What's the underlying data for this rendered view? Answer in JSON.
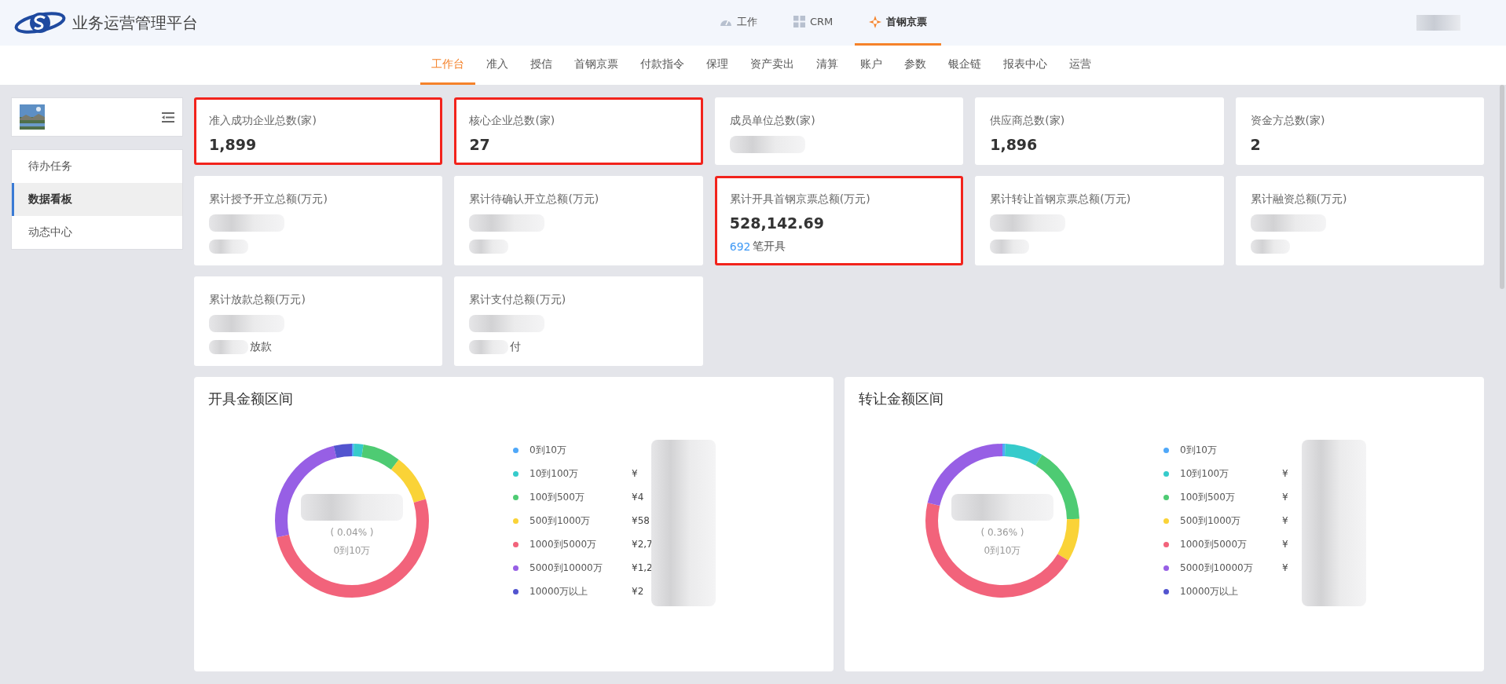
{
  "header": {
    "logo_text": "业务运营管理平台",
    "nav": [
      {
        "label": "工作",
        "selected": false
      },
      {
        "label": "CRM",
        "selected": false
      },
      {
        "label": "首钢京票",
        "selected": true
      }
    ]
  },
  "menu": [
    {
      "label": "工作台",
      "selected": true
    },
    {
      "label": "准入",
      "selected": false
    },
    {
      "label": "授信",
      "selected": false
    },
    {
      "label": "首钢京票",
      "selected": false
    },
    {
      "label": "付款指令",
      "selected": false
    },
    {
      "label": "保理",
      "selected": false
    },
    {
      "label": "资产卖出",
      "selected": false
    },
    {
      "label": "清算",
      "selected": false
    },
    {
      "label": "账户",
      "selected": false
    },
    {
      "label": "参数",
      "selected": false
    },
    {
      "label": "银企链",
      "selected": false
    },
    {
      "label": "报表中心",
      "selected": false
    },
    {
      "label": "运营",
      "selected": false
    }
  ],
  "sidebar": {
    "items": [
      {
        "label": "待办任务",
        "selected": false
      },
      {
        "label": "数据看板",
        "selected": true
      },
      {
        "label": "动态中心",
        "selected": false
      }
    ]
  },
  "cards": [
    {
      "title": "准入成功企业总数(家)",
      "value": "1,899",
      "highlighted": true
    },
    {
      "title": "核心企业总数(家)",
      "value": "27",
      "highlighted": true
    },
    {
      "title": "成员单位总数(家)",
      "redacted": true,
      "highlighted": false
    },
    {
      "title": "供应商总数(家)",
      "value": "1,896",
      "highlighted": false
    },
    {
      "title": "资金方总数(家)",
      "value": "2",
      "highlighted": false
    },
    {
      "title": "累计授予开立总额(万元)",
      "redacted": true,
      "highlighted": false,
      "footer": {
        "redacted": true
      }
    },
    {
      "title": "累计待确认开立总额(万元)",
      "redacted": true,
      "highlighted": false,
      "footer": {
        "redacted": true
      }
    },
    {
      "title": "累计开具首钢京票总额(万元)",
      "value": "528,142.69",
      "highlighted": true,
      "footer": {
        "count": "692",
        "text": "笔开具"
      }
    },
    {
      "title": "累计转让首钢京票总额(万元)",
      "redacted": true,
      "highlighted": false,
      "footer": {
        "redacted": true
      }
    },
    {
      "title": "累计融资总额(万元)",
      "redacted": true,
      "highlighted": false,
      "footer": {
        "redacted": true
      }
    },
    {
      "title": "累计放款总额(万元)",
      "redacted": true,
      "highlighted": false,
      "footer": {
        "redacted": true,
        "text": "放款"
      }
    },
    {
      "title": "累计支付总额(万元)",
      "redacted": true,
      "highlighted": false,
      "footer": {
        "redacted": true,
        "text": "付"
      }
    }
  ],
  "charts": [
    {
      "title": "开具金额区间",
      "center_percent": "( 0.04% )",
      "center_label": "0到10万",
      "legend": [
        {
          "label": "0到10万",
          "color": "#4fa8f9"
        },
        {
          "label": "10到100万",
          "color": "#36cbcb",
          "amount": "¥"
        },
        {
          "label": "100到500万",
          "color": "#4ecb73",
          "amount": "¥4"
        },
        {
          "label": "500到1000万",
          "color": "#fad337",
          "amount": "¥58"
        },
        {
          "label": "1000到5000万",
          "color": "#f2637b",
          "amount": "¥2,7"
        },
        {
          "label": "5000到10000万",
          "color": "#975fe5",
          "amount": "¥1,2"
        },
        {
          "label": "10000万以上",
          "color": "#5254cf",
          "amount": "¥2"
        }
      ]
    },
    {
      "title": "转让金额区间",
      "center_percent": "( 0.36% )",
      "center_label": "0到10万",
      "legend": [
        {
          "label": "0到10万",
          "color": "#4fa8f9"
        },
        {
          "label": "10到100万",
          "color": "#36cbcb",
          "amount": "¥"
        },
        {
          "label": "100到500万",
          "color": "#4ecb73",
          "amount": "¥"
        },
        {
          "label": "500到1000万",
          "color": "#fad337",
          "amount": "¥"
        },
        {
          "label": "1000到5000万",
          "color": "#f2637b",
          "amount": "¥"
        },
        {
          "label": "5000到10000万",
          "color": "#975fe5",
          "amount": "¥"
        },
        {
          "label": "10000万以上",
          "color": "#5254cf"
        }
      ]
    }
  ]
}
